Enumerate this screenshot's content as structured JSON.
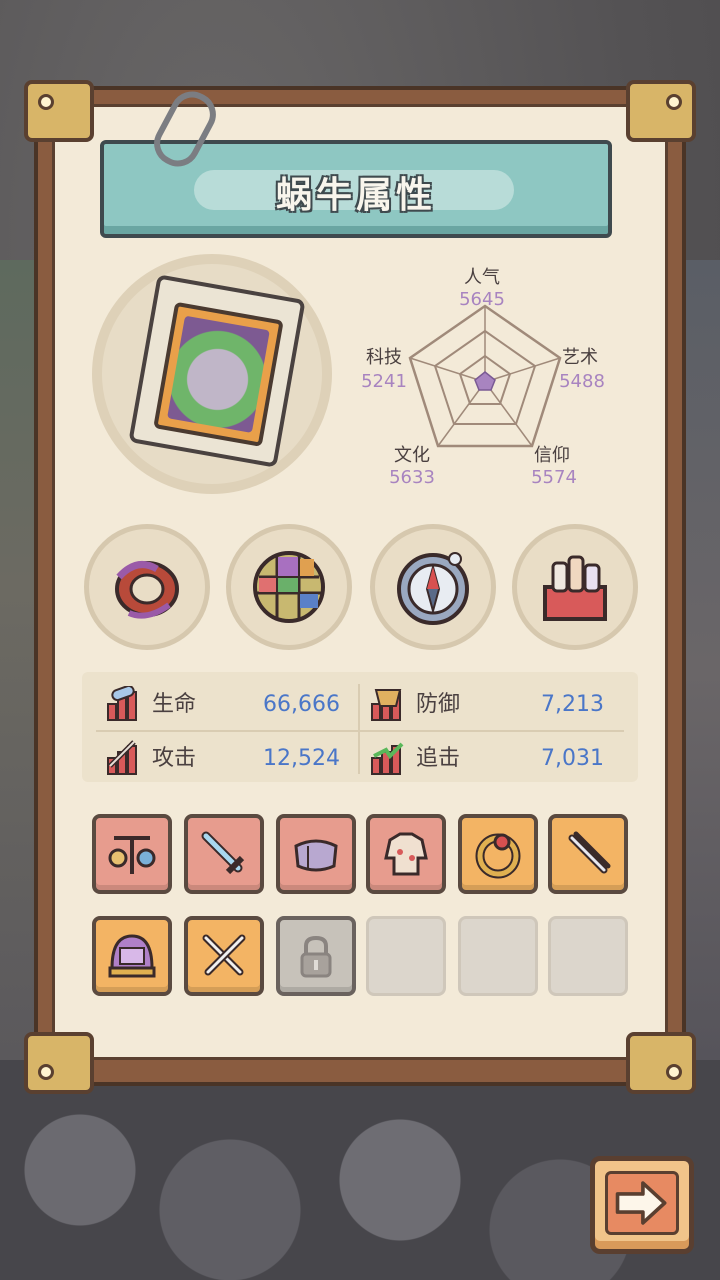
{
  "title": "蜗牛属性",
  "radar": {
    "axes": [
      {
        "label": "人气",
        "value": "5645"
      },
      {
        "label": "艺术",
        "value": "5488"
      },
      {
        "label": "信仰",
        "value": "5574"
      },
      {
        "label": "文化",
        "value": "5633"
      },
      {
        "label": "科技",
        "value": "5241"
      }
    ]
  },
  "skills": [
    {
      "icon": "tentacle-cage-icon"
    },
    {
      "icon": "rainbow-ball-icon"
    },
    {
      "icon": "compass-icon"
    },
    {
      "icon": "potion-crate-icon"
    }
  ],
  "stats": {
    "hp": {
      "label": "生命",
      "value": "66,666"
    },
    "defense": {
      "label": "防御",
      "value": "7,213"
    },
    "attack": {
      "label": "攻击",
      "value": "12,524"
    },
    "pursuit": {
      "label": "追击",
      "value": "7,031"
    }
  },
  "equipment": {
    "row1": [
      {
        "state": "red",
        "icon": "scale-weapon-icon"
      },
      {
        "state": "red",
        "icon": "sword-icon"
      },
      {
        "state": "red",
        "icon": "bracer-icon"
      },
      {
        "state": "red",
        "icon": "armor-icon"
      },
      {
        "state": "orange",
        "icon": "ring-icon"
      },
      {
        "state": "orange",
        "icon": "dual-daggers-icon"
      }
    ],
    "row2": [
      {
        "state": "orange",
        "icon": "helmet-icon"
      },
      {
        "state": "orange",
        "icon": "crossed-swords-icon"
      },
      {
        "state": "locked",
        "icon": "lock-icon"
      },
      {
        "state": "empty",
        "icon": ""
      },
      {
        "state": "empty",
        "icon": ""
      },
      {
        "state": "empty",
        "icon": ""
      }
    ]
  },
  "colors": {
    "banner": "#8ec7c2",
    "stat_value": "#4a76c8",
    "radar_value": "#a884c0",
    "slot_red": "#e79c8e",
    "slot_orange": "#f3b464"
  }
}
